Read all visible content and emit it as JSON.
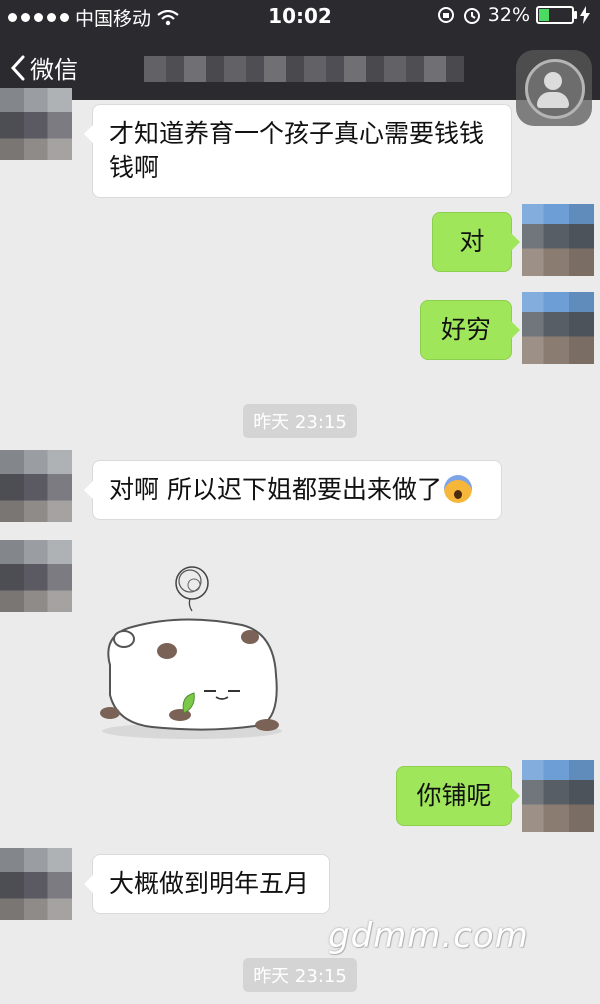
{
  "status_bar": {
    "carrier": "中国移动",
    "time": "10:02",
    "battery": "32%",
    "battery_level": 0.32
  },
  "nav": {
    "back_label": "微信"
  },
  "messages": [
    {
      "side": "left",
      "text": "才知道养育一个孩子真心需要钱钱钱啊"
    },
    {
      "side": "right",
      "text": "对"
    },
    {
      "side": "right",
      "text": "好穷"
    },
    {
      "side": "left",
      "text": "对啊 所以迟下姐都要出来做了"
    },
    {
      "side": "left",
      "type": "sticker",
      "sticker": "lying-panda-sticker"
    },
    {
      "side": "right",
      "text": "你铺呢"
    },
    {
      "side": "left",
      "text": "大概做到明年五月"
    }
  ],
  "timestamps": [
    "昨天 23:15",
    "昨天 23:15"
  ],
  "watermark": "gdmm.com",
  "colors": {
    "topbar": "#2b2a2f",
    "chat_bg": "#ebebeb",
    "self_bubble": "#9fe65a",
    "other_bubble": "#ffffff",
    "timestamp_bg": "#d4d4d4"
  }
}
